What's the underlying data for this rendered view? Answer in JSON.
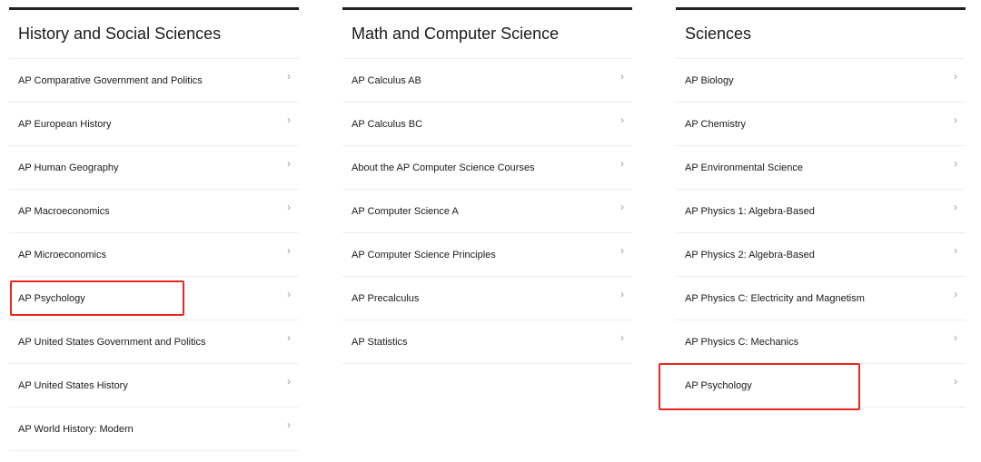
{
  "columns": [
    {
      "title": "History and Social Sciences",
      "items": [
        "AP Comparative Government and Politics",
        "AP European History",
        "AP Human Geography",
        "AP Macroeconomics",
        "AP Microeconomics",
        "AP Psychology",
        "AP United States Government and Politics",
        "AP United States History",
        "AP World History: Modern"
      ]
    },
    {
      "title": "Math and Computer Science",
      "items": [
        "AP Calculus AB",
        "AP Calculus BC",
        "About the AP Computer Science Courses",
        "AP Computer Science A",
        "AP Computer Science Principles",
        "AP Precalculus",
        "AP Statistics"
      ]
    },
    {
      "title": "Sciences",
      "items": [
        "AP Biology",
        "AP Chemistry",
        "AP Environmental Science",
        "AP Physics 1: Algebra-Based",
        "AP Physics 2: Algebra-Based",
        "AP Physics C: Electricity and Magnetism",
        "AP Physics C: Mechanics",
        "AP Psychology"
      ]
    }
  ],
  "chevron_icon": "chevron-right-icon",
  "highlight_color": "#e8281e"
}
